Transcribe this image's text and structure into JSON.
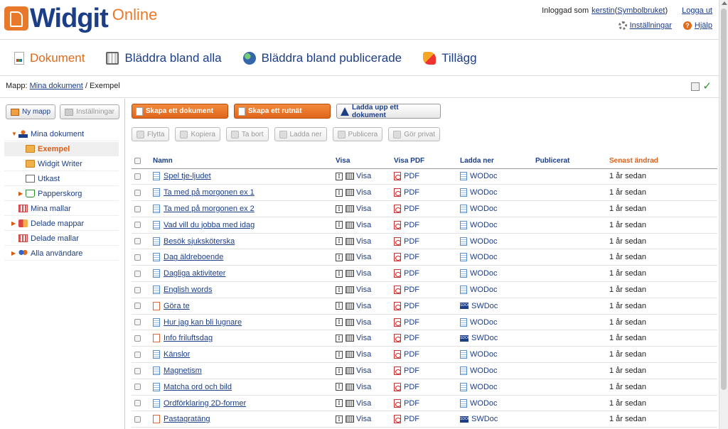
{
  "header": {
    "logo_word": "Widgit",
    "logo_online": "Online",
    "logged_in_prefix": "Inloggad som",
    "username": "kerstin",
    "account_paren_open": "(",
    "account_type": "Symbolbruket",
    "account_paren_close": ")",
    "logout": "Logga ut",
    "settings": "Inställningar",
    "help": "Hjälp"
  },
  "nav": {
    "tabs": [
      {
        "label": "Dokument",
        "icon": "document-icon"
      },
      {
        "label": "Bläddra bland alla",
        "icon": "screen-icon"
      },
      {
        "label": "Bläddra bland publicerade",
        "icon": "globe-icon"
      },
      {
        "label": "Tillägg",
        "icon": "plugin-icon"
      }
    ]
  },
  "breadcrumb": {
    "prefix": "Mapp:",
    "root": "Mina dokument",
    "sep": "/",
    "current": "Exempel"
  },
  "sidebar": {
    "new_folder": "Ny mapp",
    "settings": "Inställningar",
    "tree": [
      {
        "label": "Mina dokument",
        "icon": "user-icon"
      },
      {
        "label": "Exempel",
        "icon": "folder-icon"
      },
      {
        "label": "Widgit Writer",
        "icon": "folder-icon"
      },
      {
        "label": "Utkast",
        "icon": "writer-icon"
      },
      {
        "label": "Papperskorg",
        "icon": "trash-icon"
      },
      {
        "label": "Mina mallar",
        "icon": "grid-icon"
      },
      {
        "label": "Delade mappar",
        "icon": "shared-folder-icon"
      },
      {
        "label": "Delade mallar",
        "icon": "grid-icon"
      },
      {
        "label": "Alla användare",
        "icon": "group-icon"
      }
    ]
  },
  "actions": {
    "create_document": "Skapa ett dokument",
    "create_grid": "Skapa ett rutnät",
    "upload": "Ladda upp ett dokument"
  },
  "ops": {
    "move": "Flytta",
    "copy": "Kopiera",
    "delete": "Ta bort",
    "download": "Ladda ner",
    "publish": "Publicera",
    "private": "Gör privat"
  },
  "table": {
    "headers": {
      "name": "Namn",
      "view": "Visa",
      "view_pdf": "Visa PDF",
      "download": "Ladda ner",
      "published": "Publicerat",
      "modified": "Senast ändrad"
    },
    "text_glyph": "I",
    "view_label": "Visa",
    "pdf_label": "PDF",
    "sw_badge": "SDOC",
    "rows": [
      {
        "name": "Spel tje-ljudet",
        "type": "WODoc",
        "modified": "1 år sedan"
      },
      {
        "name": "Ta med på morgonen ex 1",
        "type": "WODoc",
        "modified": "1 år sedan"
      },
      {
        "name": "Ta med på morgonen ex 2",
        "type": "WODoc",
        "modified": "1 år sedan"
      },
      {
        "name": "Vad vill du jobba med idag",
        "type": "WODoc",
        "modified": "1 år sedan"
      },
      {
        "name": "Besök sjuksköterska",
        "type": "WODoc",
        "modified": "1 år sedan"
      },
      {
        "name": "Dag äldreboende",
        "type": "WODoc",
        "modified": "1 år sedan"
      },
      {
        "name": "Dagliga aktiviteter",
        "type": "WODoc",
        "modified": "1 år sedan"
      },
      {
        "name": "English words",
        "type": "WODoc",
        "modified": "1 år sedan"
      },
      {
        "name": "Göra te",
        "type": "SWDoc",
        "modified": "1 år sedan"
      },
      {
        "name": "Hur jag kan bli lugnare",
        "type": "WODoc",
        "modified": "1 år sedan"
      },
      {
        "name": "Info friluftsdag",
        "type": "SWDoc",
        "modified": "1 år sedan"
      },
      {
        "name": "Känslor",
        "type": "WODoc",
        "modified": "1 år sedan"
      },
      {
        "name": "Magnetism",
        "type": "WODoc",
        "modified": "1 år sedan"
      },
      {
        "name": "Matcha ord och bild",
        "type": "WODoc",
        "modified": "1 år sedan"
      },
      {
        "name": "Ordförklaring 2D-former",
        "type": "WODoc",
        "modified": "1 år sedan"
      },
      {
        "name": "Pastagratäng",
        "type": "SWDoc",
        "modified": "1 år sedan"
      }
    ]
  }
}
